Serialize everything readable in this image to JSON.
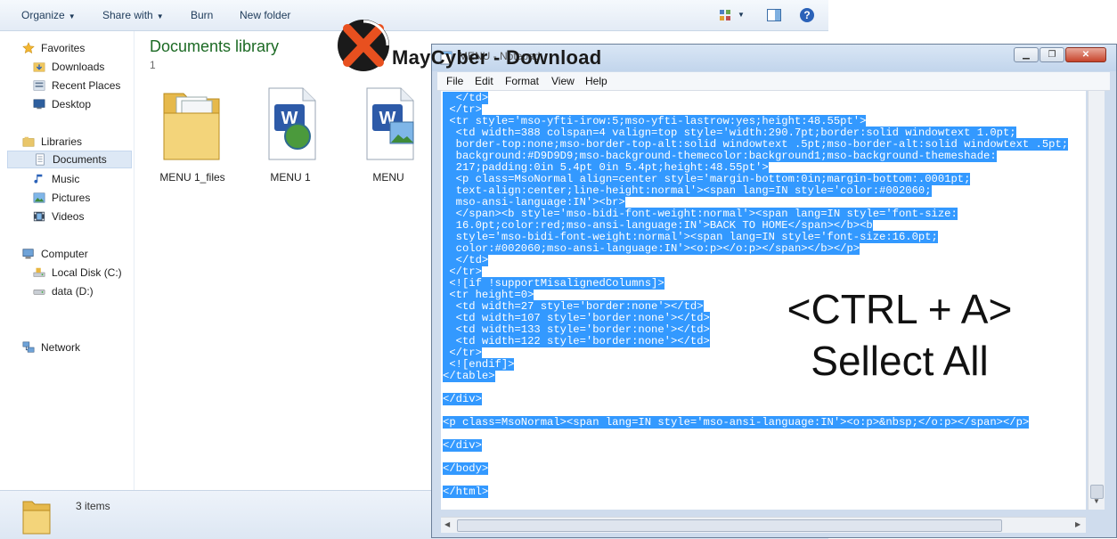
{
  "explorer": {
    "toolbar": {
      "organize": "Organize",
      "share_with": "Share with",
      "burn": "Burn",
      "new_folder": "New folder"
    },
    "nav": {
      "favorites": "Favorites",
      "downloads": "Downloads",
      "recent_places": "Recent Places",
      "desktop": "Desktop",
      "libraries": "Libraries",
      "documents": "Documents",
      "music": "Music",
      "pictures": "Pictures",
      "videos": "Videos",
      "computer": "Computer",
      "local_disk": "Local Disk (C:)",
      "data_drive": "data (D:)",
      "network": "Network"
    },
    "library_title": "Documents library",
    "library_subtitle": "1",
    "files": [
      {
        "name": "MENU 1_files",
        "icon": "folder-icon"
      },
      {
        "name": "MENU 1",
        "icon": "word-document-icon"
      },
      {
        "name": "MENU",
        "icon": "word-document-icon"
      }
    ],
    "status": {
      "items_count": "3 items"
    }
  },
  "watermark": {
    "text": "MayCyber - Download",
    "accent": "#e8501f"
  },
  "notepad": {
    "title": "MENU - Notepad",
    "menu": [
      "File",
      "Edit",
      "Format",
      "View",
      "Help"
    ],
    "selection_color": "#3399ff",
    "lines": [
      "  </td>",
      " </tr>",
      " <tr style='mso-yfti-irow:5;mso-yfti-lastrow:yes;height:48.55pt'>",
      "  <td width=388 colspan=4 valign=top style='width:290.7pt;border:solid windowtext 1.0pt;",
      "  border-top:none;mso-border-top-alt:solid windowtext .5pt;mso-border-alt:solid windowtext .5pt;",
      "  background:#D9D9D9;mso-background-themecolor:background1;mso-background-themeshade:",
      "  217;padding:0in 5.4pt 0in 5.4pt;height:48.55pt'>",
      "  <p class=MsoNormal align=center style='margin-bottom:0in;margin-bottom:.0001pt;",
      "  text-align:center;line-height:normal'><span lang=IN style='color:#002060;",
      "  mso-ansi-language:IN'><br>",
      "  </span><b style='mso-bidi-font-weight:normal'><span lang=IN style='font-size:",
      "  16.0pt;color:red;mso-ansi-language:IN'>BACK TO HOME</span></b><b",
      "  style='mso-bidi-font-weight:normal'><span lang=IN style='font-size:16.0pt;",
      "  color:#002060;mso-ansi-language:IN'><o:p></o:p></span></b></p>",
      "  </td>",
      " </tr>",
      " <![if !supportMisalignedColumns]>",
      " <tr height=0>",
      "  <td width=27 style='border:none'></td>",
      "  <td width=107 style='border:none'></td>",
      "  <td width=133 style='border:none'></td>",
      "  <td width=122 style='border:none'></td>",
      " </tr>",
      " <![endif]>",
      "</table>",
      "",
      "</div>",
      "",
      "<p class=MsoNormal><span lang=IN style='mso-ansi-language:IN'><o:p>&nbsp;</o:p></span></p>",
      "",
      "</div>",
      "",
      "</body>",
      "",
      "</html>"
    ]
  },
  "annotation": {
    "line1": "<CTRL + A>",
    "line2": "Sellect All"
  }
}
